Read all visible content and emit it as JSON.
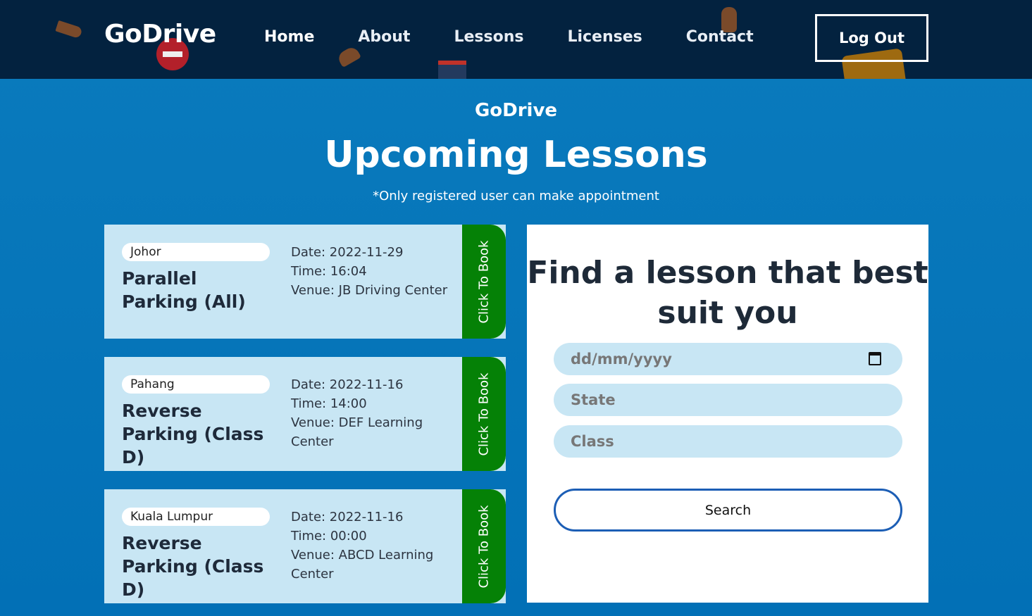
{
  "header": {
    "brand": "GoDrive",
    "nav": [
      "Home",
      "About",
      "Lessons",
      "Licenses",
      "Contact"
    ],
    "logout_label": "Log Out"
  },
  "hero": {
    "site_name": "GoDrive",
    "title": "Upcoming Lessons",
    "note": "*Only registered user can make appointment"
  },
  "lessons": [
    {
      "state": "Johor",
      "name": "Parallel Parking (All)",
      "date": "Date: 2022-11-29",
      "time": "Time: 16:04",
      "venue": "Venue: JB Driving Center",
      "book_label": "Click To Book"
    },
    {
      "state": "Pahang",
      "name": "Reverse Parking (Class D)",
      "date": "Date: 2022-11-16",
      "time": "Time: 14:00",
      "venue": "Venue: DEF Learning Center",
      "book_label": "Click To Book"
    },
    {
      "state": "Kuala Lumpur",
      "name": "Reverse Parking (Class D)",
      "date": "Date: 2022-11-16",
      "time": "Time: 00:00",
      "venue": "Venue: ABCD Learning Center",
      "book_label": "Click To Book"
    }
  ],
  "search": {
    "title": "Find a lesson that best suit you",
    "date_placeholder": "dd/mm/yyyy",
    "state_placeholder": "State",
    "class_placeholder": "Class",
    "button_label": "Search"
  },
  "colors": {
    "header_bg": "#03223f",
    "page_bg": "#0270b6",
    "card_bg": "#c8e6f4",
    "book_green": "#058106",
    "search_border": "#1c5eb5"
  }
}
